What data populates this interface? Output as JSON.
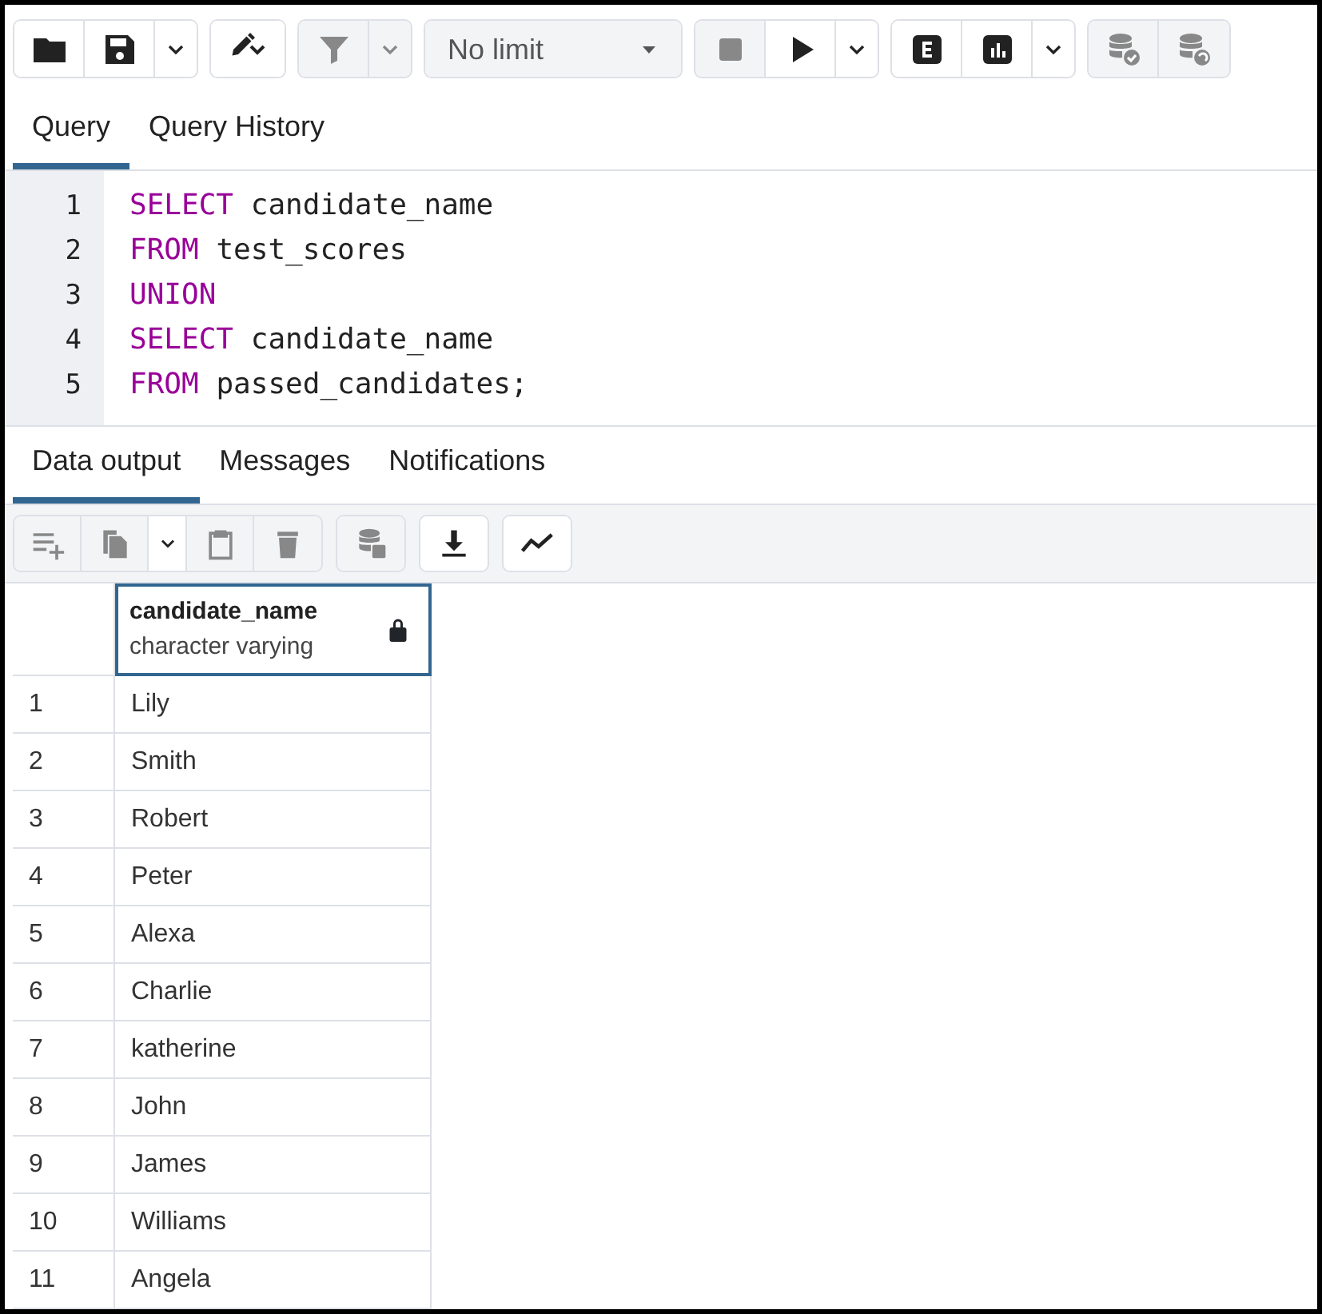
{
  "toolbar": {
    "groups": [
      {
        "buttons": [
          {
            "disabled": false
          },
          {
            "disabled": false
          },
          {
            "disabled": false
          }
        ]
      },
      {
        "buttons": [
          {
            "disabled": false
          }
        ]
      },
      {
        "buttons": [
          {
            "disabled": true
          },
          {
            "disabled": true
          }
        ]
      },
      {
        "select": {
          "value": "No limit"
        }
      },
      {
        "buttons": [
          {
            "disabled": true
          },
          {
            "disabled": false
          },
          {
            "disabled": false
          }
        ]
      },
      {
        "buttons": [
          {
            "disabled": false
          },
          {
            "disabled": false
          },
          {
            "disabled": false
          }
        ]
      },
      {
        "buttons": [
          {
            "disabled": true
          },
          {
            "disabled": true
          }
        ]
      }
    ]
  },
  "query_tabs": [
    {
      "label": "Query",
      "selected": true
    },
    {
      "label": "Query History",
      "selected": false
    }
  ],
  "editor": {
    "lines": [
      {
        "number": "1",
        "tokens": [
          {
            "kind": "keyword",
            "text": "SELECT"
          },
          {
            "kind": "plain",
            "text": " candidate_name"
          }
        ]
      },
      {
        "number": "2",
        "tokens": [
          {
            "kind": "keyword",
            "text": "FROM"
          },
          {
            "kind": "plain",
            "text": " test_scores"
          }
        ]
      },
      {
        "number": "3",
        "tokens": [
          {
            "kind": "keyword",
            "text": "UNION"
          }
        ]
      },
      {
        "number": "4",
        "tokens": [
          {
            "kind": "keyword",
            "text": "SELECT"
          },
          {
            "kind": "plain",
            "text": " candidate_name"
          }
        ]
      },
      {
        "number": "5",
        "tokens": [
          {
            "kind": "keyword",
            "text": "FROM"
          },
          {
            "kind": "plain",
            "text": " passed_candidates;"
          }
        ]
      }
    ]
  },
  "output_tabs": [
    {
      "label": "Data output",
      "selected": true
    },
    {
      "label": "Messages",
      "selected": false
    },
    {
      "label": "Notifications",
      "selected": false
    }
  ],
  "output_toolbar": {
    "groups": [
      {
        "buttons": [
          {
            "disabled": true
          },
          {
            "disabled": true
          },
          {
            "disabled": false
          },
          {
            "disabled": true
          },
          {
            "disabled": true
          }
        ]
      },
      {
        "buttons": [
          {
            "disabled": true
          }
        ]
      },
      {
        "buttons": [
          {
            "disabled": false
          }
        ]
      },
      {
        "buttons": [
          {
            "disabled": false
          }
        ]
      }
    ]
  },
  "table": {
    "columns": [
      {
        "name": "candidate_name",
        "type": "character varying",
        "locked": true
      }
    ],
    "rows": [
      {
        "number": "1",
        "cells": [
          "Lily"
        ]
      },
      {
        "number": "2",
        "cells": [
          "Smith"
        ]
      },
      {
        "number": "3",
        "cells": [
          "Robert"
        ]
      },
      {
        "number": "4",
        "cells": [
          "Peter"
        ]
      },
      {
        "number": "5",
        "cells": [
          "Alexa"
        ]
      },
      {
        "number": "6",
        "cells": [
          "Charlie"
        ]
      },
      {
        "number": "7",
        "cells": [
          "katherine"
        ]
      },
      {
        "number": "8",
        "cells": [
          "John"
        ]
      },
      {
        "number": "9",
        "cells": [
          "James"
        ]
      },
      {
        "number": "10",
        "cells": [
          "Williams"
        ]
      },
      {
        "number": "11",
        "cells": [
          "Angela"
        ]
      }
    ]
  }
}
